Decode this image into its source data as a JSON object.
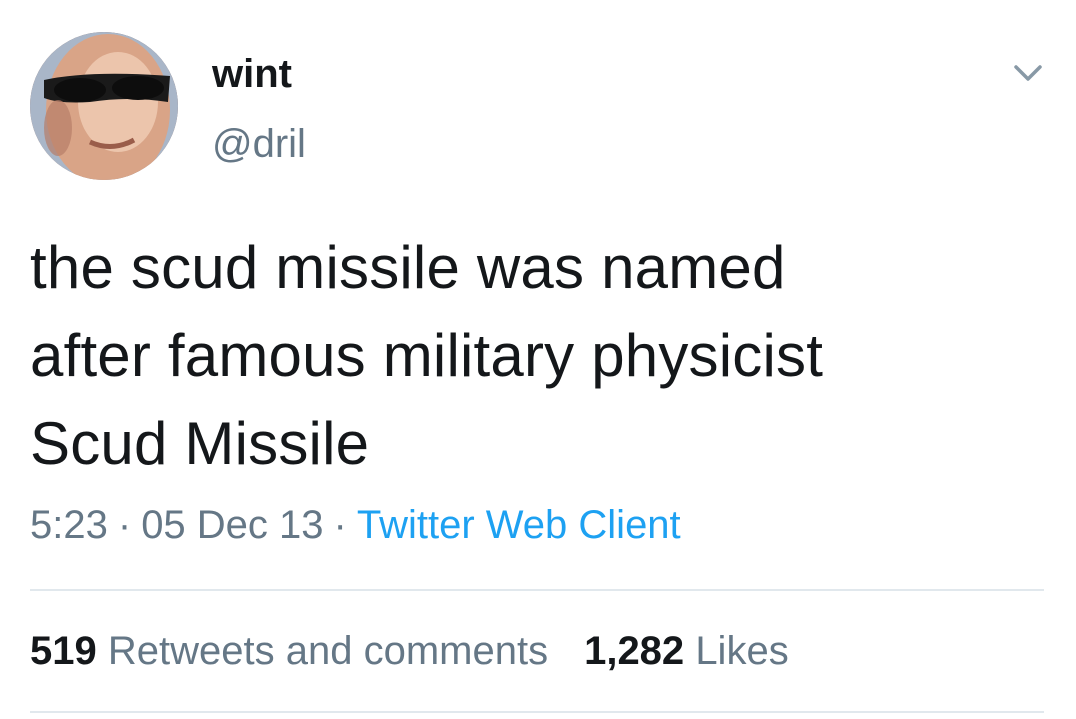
{
  "user": {
    "display_name": "wint",
    "handle": "@dril"
  },
  "tweet": {
    "lines": [
      "the scud missile was named",
      "after famous military physicist",
      "Scud Missile"
    ]
  },
  "meta": {
    "time": "5:23",
    "separator": "·",
    "date": "05 Dec 13",
    "source": "Twitter Web Client"
  },
  "stats": {
    "retweets_count": "519",
    "retweets_label": "Retweets and comments",
    "likes_count": "1,282",
    "likes_label": "Likes"
  },
  "icons": {
    "menu": "chevron-down-icon"
  },
  "colors": {
    "text": "#14171a",
    "secondary": "#657786",
    "link": "#1da1f2",
    "divider": "#e1e8ed"
  }
}
